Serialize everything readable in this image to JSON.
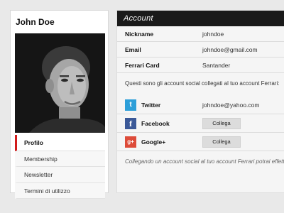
{
  "profile": {
    "name": "John Doe",
    "menu": [
      {
        "label": "Profilo",
        "active": true
      },
      {
        "label": "Membership",
        "active": false
      },
      {
        "label": "Newsletter",
        "active": false
      },
      {
        "label": "Termini di utilizzo",
        "active": false
      }
    ]
  },
  "account": {
    "title": "Account",
    "fields": [
      {
        "label": "Nickname",
        "value": "johndoe"
      },
      {
        "label": "Email",
        "value": "johndoe@gmail.com"
      },
      {
        "label": "Ferrari Card",
        "value": "Santander"
      }
    ],
    "social_intro": "Questi sono gli account social collegati al tuo account Ferrari:",
    "social": [
      {
        "name": "Twitter",
        "icon": "twitter-icon",
        "value": "johndoe@yahoo.com",
        "button": ""
      },
      {
        "name": "Facebook",
        "icon": "facebook-icon",
        "value": "",
        "button": "Collega"
      },
      {
        "name": "Google+",
        "icon": "google-plus-icon",
        "value": "",
        "button": "Collega"
      }
    ],
    "footer_note": "Collegando un account social al tuo account Ferrari potrai effettuare"
  },
  "colors": {
    "accent": "#d11b1b",
    "header_bg": "#1a1a1a",
    "twitter": "#2d9fd9",
    "facebook": "#3b5998",
    "google": "#dd4b39"
  }
}
